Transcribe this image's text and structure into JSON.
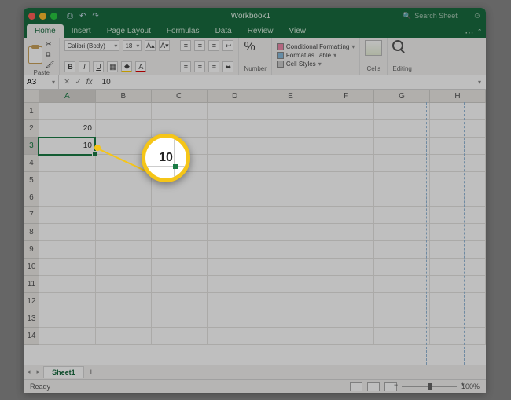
{
  "titlebar": {
    "title": "Workbook1",
    "search_placeholder": "Search Sheet"
  },
  "tabs": [
    "Home",
    "Insert",
    "Page Layout",
    "Formulas",
    "Data",
    "Review",
    "View"
  ],
  "active_tab": "Home",
  "ribbon": {
    "paste_label": "Paste",
    "font_name": "Calibri (Body)",
    "font_size": "18",
    "number_label": "Number",
    "cond_fmt": "Conditional Formatting",
    "fmt_table": "Format as Table",
    "cell_styles": "Cell Styles",
    "cells_label": "Cells",
    "editing_label": "Editing"
  },
  "formula_bar": {
    "cell_ref": "A3",
    "value": "10"
  },
  "columns": [
    "A",
    "B",
    "C",
    "D",
    "E",
    "F",
    "G",
    "H"
  ],
  "rows": [
    "1",
    "2",
    "3",
    "4",
    "5",
    "6",
    "7",
    "8",
    "9",
    "10",
    "11",
    "12",
    "13",
    "14"
  ],
  "cells": {
    "A2": "20",
    "A3": "10"
  },
  "callout_value": "10",
  "sheet_tab": "Sheet1",
  "status_text": "Ready",
  "zoom": "100%"
}
